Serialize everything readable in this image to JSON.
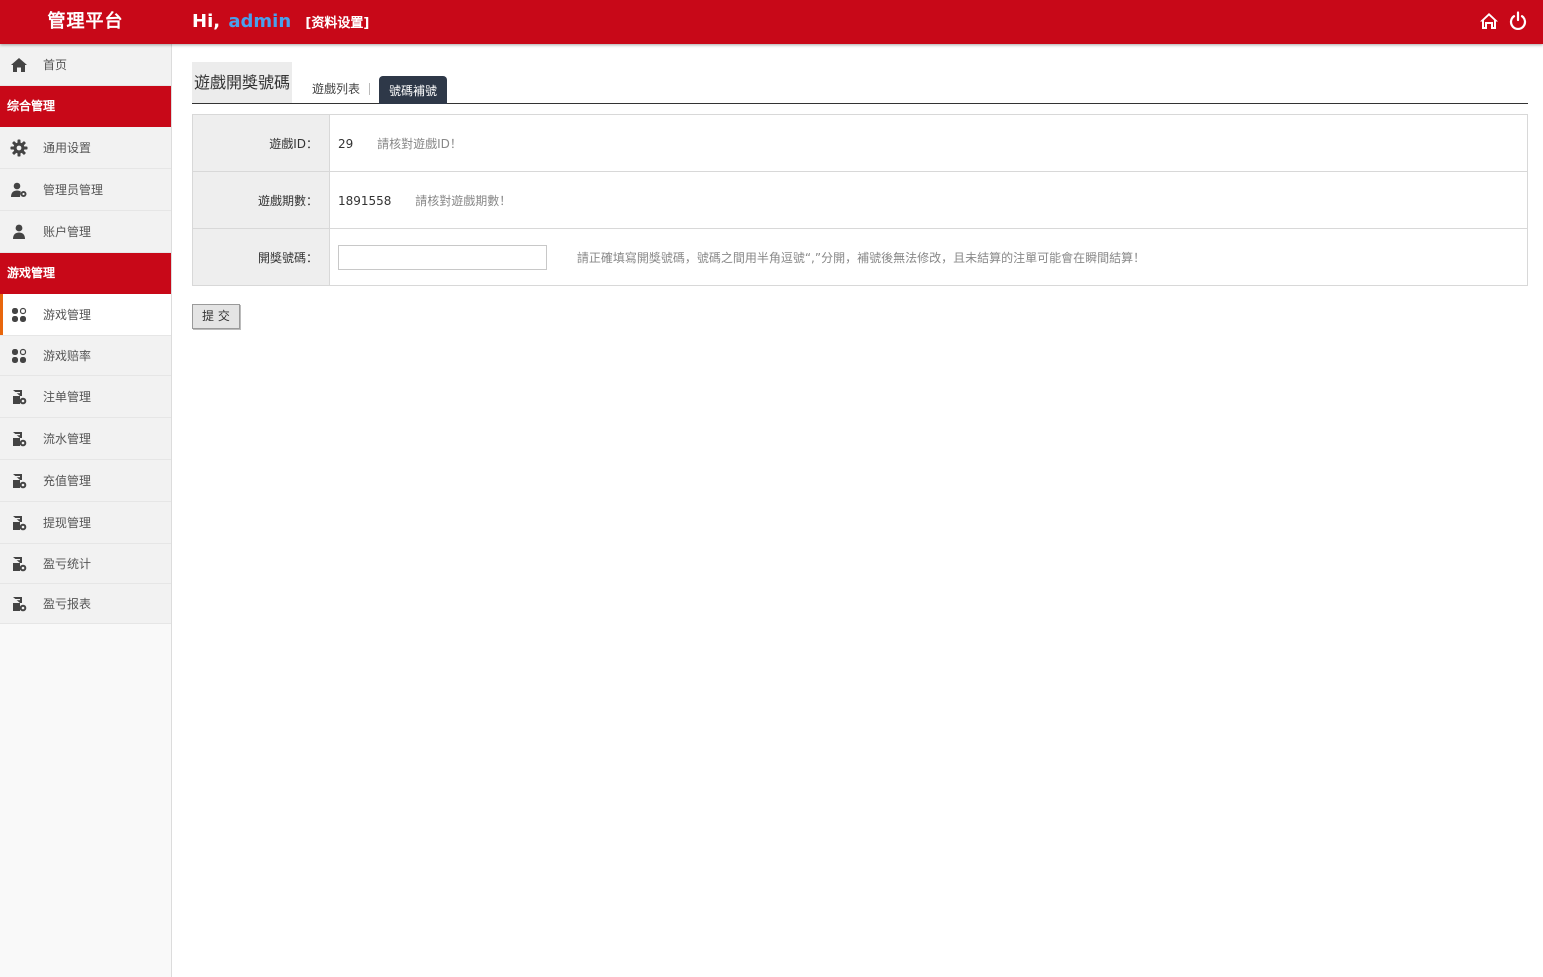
{
  "header": {
    "brand": "管理平台",
    "greeting_prefix": "Hi,",
    "username": "admin",
    "profile_link": "[资料设置]"
  },
  "sidebar": {
    "home": "首页",
    "sections": [
      {
        "title": "综合管理",
        "items": [
          "通用设置",
          "管理员管理",
          "账户管理"
        ]
      },
      {
        "title": "游戏管理",
        "items": [
          "游戏管理",
          "游戏赔率",
          "注单管理",
          "流水管理",
          "充值管理",
          "提现管理",
          "盈亏统计",
          "盈亏报表"
        ]
      }
    ],
    "active_item": "游戏管理"
  },
  "main": {
    "page_title": "遊戲開獎號碼",
    "tabs": [
      "遊戲列表",
      "號碼補號"
    ],
    "active_tab": "號碼補號",
    "form": {
      "game_id_label": "遊戲ID：",
      "game_id_value": "29",
      "game_id_hint": "請核對遊戲ID！",
      "period_label": "遊戲期數：",
      "period_value": "1891558",
      "period_hint": "請核對遊戲期數！",
      "number_label": "開獎號碼：",
      "number_value": "",
      "number_placeholder": "",
      "number_hint": "請正確填寫開獎號碼，號碼之間用半角逗號“,”分開，補號後無法修改，且未結算的注單可能會在瞬間結算！",
      "submit_label": "提 交"
    }
  },
  "colors": {
    "brand_red": "#c80818",
    "username_blue": "#4aa0ec",
    "active_tab_bg": "#2e3848",
    "active_indicator": "#e8660c"
  }
}
